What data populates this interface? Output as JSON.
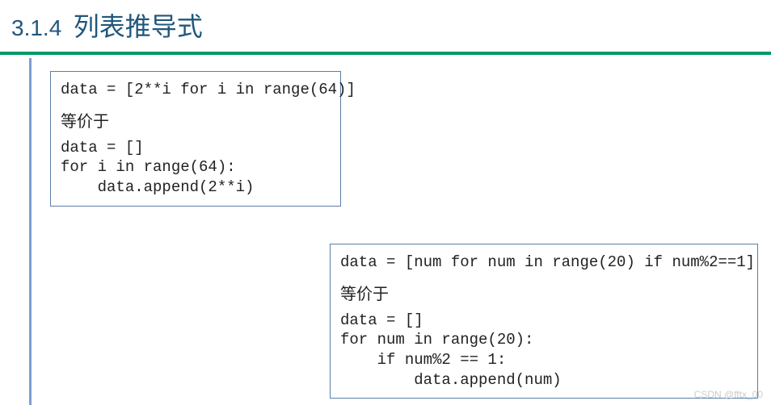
{
  "header": {
    "number": "3.1.4",
    "title": "列表推导式"
  },
  "box1": {
    "code1": "data = [2**i for i in range(64)]",
    "equiv": "等价于",
    "code2_line1": "data = []",
    "code2_line2": "for i in range(64):",
    "code2_line3": "    data.append(2**i)"
  },
  "box2": {
    "code1": "data = [num for num in range(20) if num%2==1]",
    "equiv": "等价于",
    "code2_line1": "data = []",
    "code2_line2": "for num in range(20):",
    "code2_line3": "    if num%2 == 1:",
    "code2_line4": "        data.append(num)"
  },
  "watermark": "CSDN @fftx_00"
}
